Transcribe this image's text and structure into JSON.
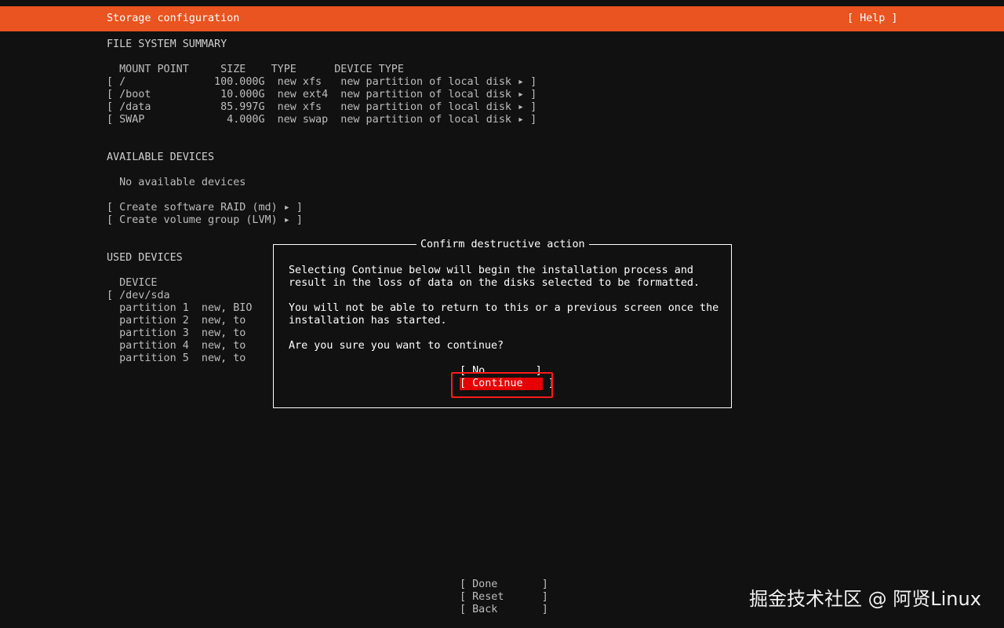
{
  "header": {
    "title": "Storage configuration",
    "help": "[ Help ]"
  },
  "fs_summary": {
    "heading": "FILE SYSTEM SUMMARY",
    "columns": "  MOUNT POINT     SIZE    TYPE      DEVICE TYPE",
    "rows": [
      "[ /              100.000G  new xfs   new partition of local disk ▸ ]",
      "[ /boot           10.000G  new ext4  new partition of local disk ▸ ]",
      "[ /data           85.997G  new xfs   new partition of local disk ▸ ]",
      "[ SWAP             4.000G  new swap  new partition of local disk ▸ ]"
    ]
  },
  "available": {
    "heading": "AVAILABLE DEVICES",
    "none": "  No available devices",
    "raid": "[ Create software RAID (md) ▸ ]",
    "lvm": "[ Create volume group (LVM) ▸ ]"
  },
  "used": {
    "heading": "USED DEVICES",
    "col": "  DEVICE",
    "device": "[ /dev/sda",
    "partitions": [
      "  partition 1  new, BIO",
      "  partition 2  new, to",
      "  partition 3  new, to",
      "  partition 4  new, to",
      "  partition 5  new, to"
    ]
  },
  "dialog": {
    "title": "Confirm destructive action",
    "line1": "Selecting Continue below will begin the installation process and",
    "line2": "result in the loss of data on the disks selected to be formatted.",
    "line3": "You will not be able to return to this or a previous screen once the",
    "line4": "installation has started.",
    "line5": "Are you sure you want to continue?",
    "no": "[ No        ]",
    "continue": "[ Continue    ]"
  },
  "footer": {
    "done": "[ Done       ]",
    "reset": "[ Reset      ]",
    "back": "[ Back       ]"
  },
  "watermark": "掘金技术社区 @ 阿贤Linux",
  "colors": {
    "header": "#e95420",
    "background": "#111111",
    "selected": "#e60000"
  }
}
